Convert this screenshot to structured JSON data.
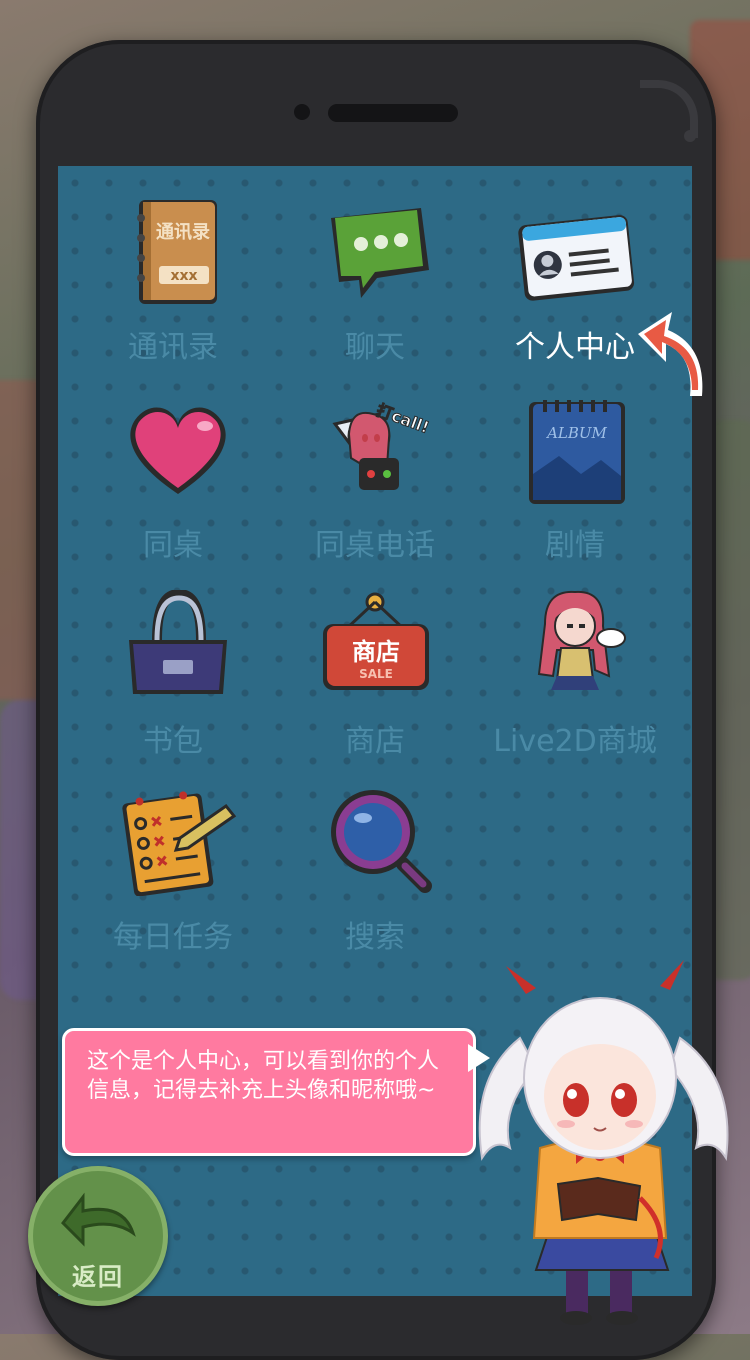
{
  "apps": [
    {
      "id": "contacts",
      "label": "通讯录",
      "icon": "address-book-icon",
      "icon_text": "通讯录",
      "active": false
    },
    {
      "id": "chat",
      "label": "聊天",
      "icon": "chat-bubble-icon",
      "active": false
    },
    {
      "id": "profile",
      "label": "个人中心",
      "icon": "student-id-card-icon",
      "active": true
    },
    {
      "id": "deskmate",
      "label": "同桌",
      "icon": "heart-icon",
      "active": false
    },
    {
      "id": "deskmate-call",
      "label": "同桌电话",
      "icon": "deskmate-call-icon",
      "icon_text": "打call!",
      "active": false
    },
    {
      "id": "story",
      "label": "剧情",
      "icon": "album-icon",
      "icon_text": "ALBUM",
      "active": false
    },
    {
      "id": "bag",
      "label": "书包",
      "icon": "school-bag-icon",
      "active": false
    },
    {
      "id": "shop",
      "label": "商店",
      "icon": "shop-sign-icon",
      "icon_text": "商店",
      "icon_subtext": "SALE",
      "active": false
    },
    {
      "id": "live2d-shop",
      "label": "Live2D商城",
      "icon": "live2d-character-icon",
      "active": false
    },
    {
      "id": "daily-tasks",
      "label": "每日任务",
      "icon": "task-list-icon",
      "active": false
    },
    {
      "id": "search",
      "label": "搜索",
      "icon": "magnifier-icon",
      "active": false
    }
  ],
  "tutorial": {
    "message": "这个是个人中心，可以看到你的个人信息，记得去补充上头像和昵称哦~"
  },
  "back_button": {
    "label": "返回",
    "icon": "back-arrow-icon"
  },
  "colors": {
    "screen": "#2d6a86",
    "label_inactive": "#4a8aa6",
    "label_active": "#ffffff",
    "bubble": "#ff7aa0",
    "arrow": "#e85a44",
    "back_button": "#63914a"
  }
}
